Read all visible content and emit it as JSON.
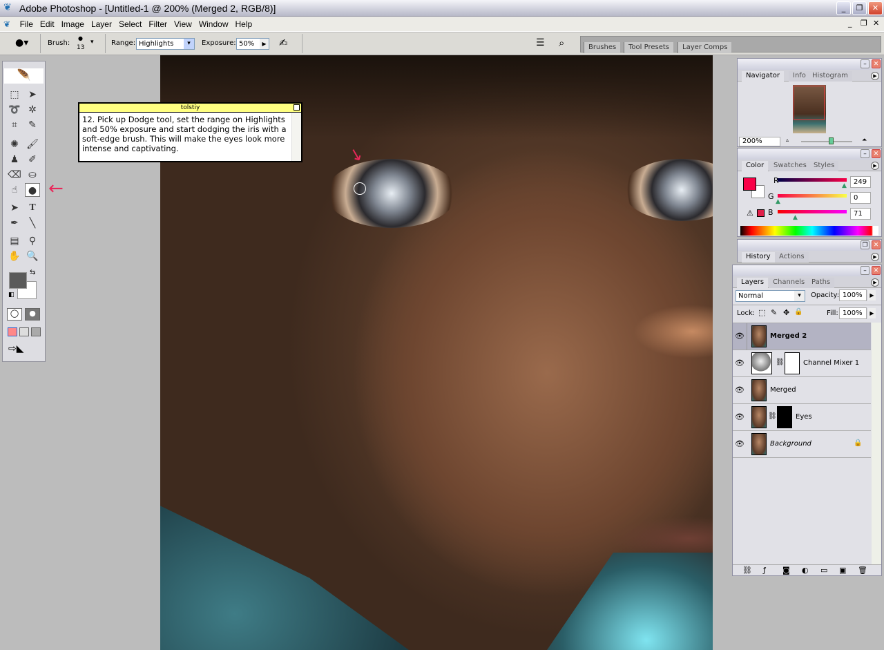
{
  "window": {
    "title": "Adobe Photoshop - [Untitled-1 @ 200% (Merged 2, RGB/8)]"
  },
  "menu": [
    "File",
    "Edit",
    "Image",
    "Layer",
    "Select",
    "Filter",
    "View",
    "Window",
    "Help"
  ],
  "options": {
    "brush_label": "Brush:",
    "brush_size": "13",
    "range_label": "Range:",
    "range_value": "Highlights",
    "exposure_label": "Exposure:",
    "exposure_value": "50%"
  },
  "well_tabs": [
    "Brushes",
    "Tool Presets",
    "Layer Comps"
  ],
  "note": {
    "author": "tolstiy",
    "text": "12. Pick up Dodge tool, set the range on Highlights and 50% exposure and start dodging the iris with a soft-edge brush. This will make the eyes look more intense and captivating."
  },
  "navigator": {
    "tabs": [
      "Navigator",
      "Info",
      "Histogram"
    ],
    "zoom": "200%",
    "slider_fraction": 0.6
  },
  "color": {
    "tabs": [
      "Color",
      "Swatches",
      "Styles"
    ],
    "r_label": "R",
    "g_label": "G",
    "b_label": "B",
    "r": "249",
    "g": "0",
    "b": "71",
    "foreground": "#f90047"
  },
  "history": {
    "tabs": [
      "History",
      "Actions"
    ]
  },
  "layers": {
    "tabs": [
      "Layers",
      "Channels",
      "Paths"
    ],
    "blend_mode": "Normal",
    "opacity_label": "Opacity:",
    "opacity": "100%",
    "lock_label": "Lock:",
    "fill_label": "Fill:",
    "fill": "100%",
    "items": [
      {
        "name": "Merged 2"
      },
      {
        "name": "Channel Mixer 1"
      },
      {
        "name": "Merged"
      },
      {
        "name": "Eyes"
      },
      {
        "name": "Background"
      }
    ]
  }
}
